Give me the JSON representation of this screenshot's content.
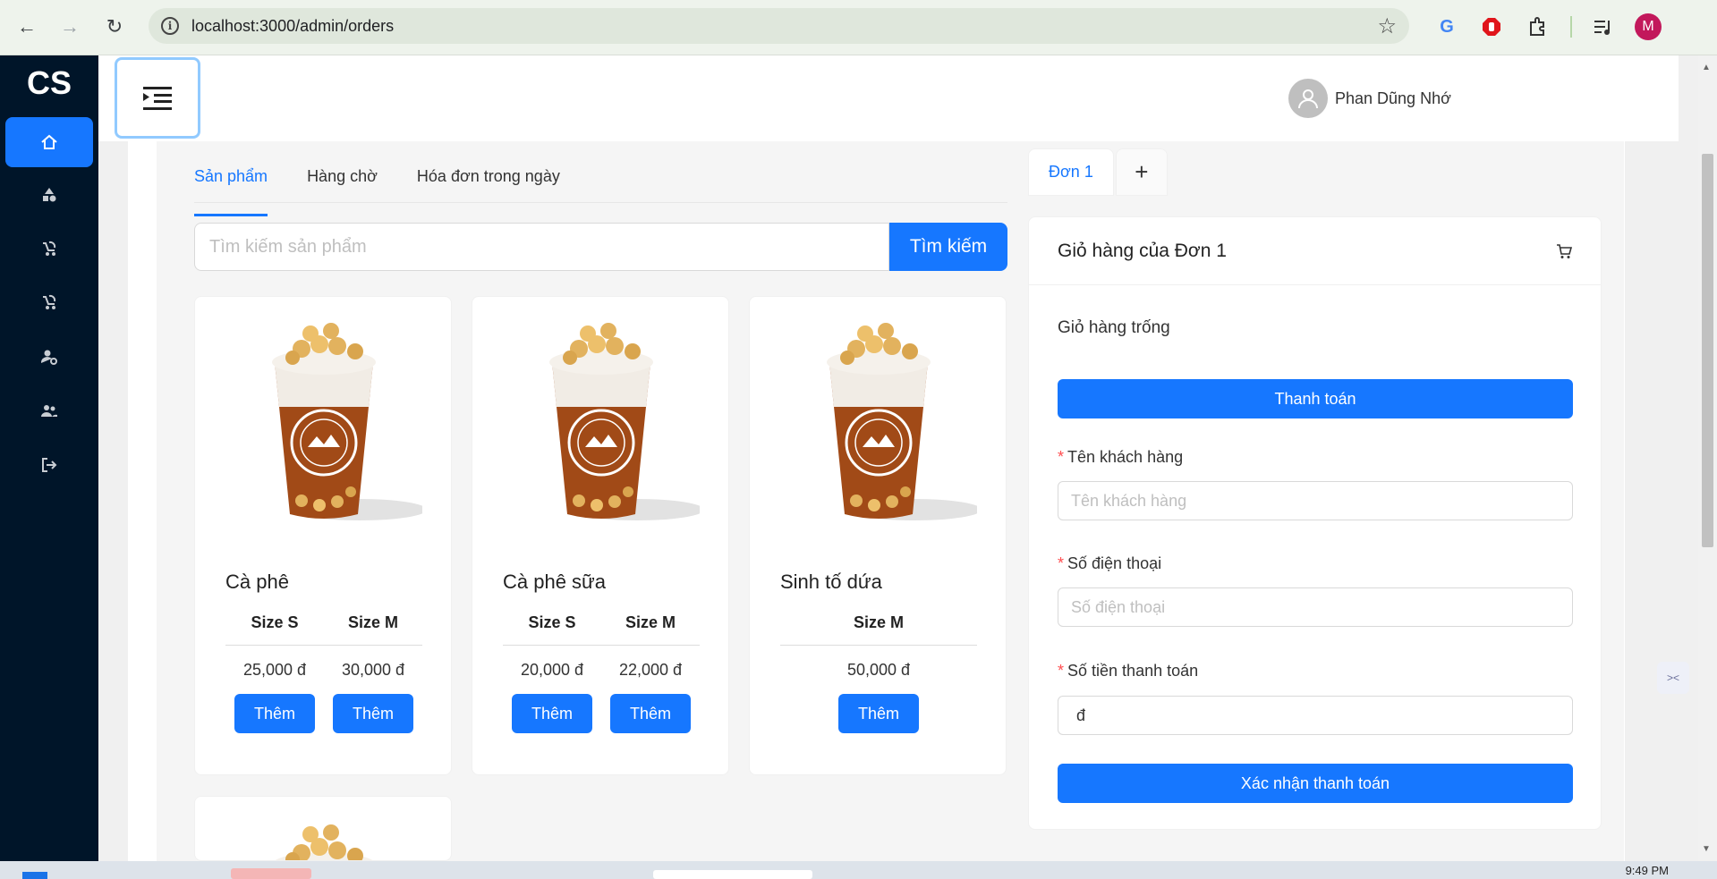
{
  "browser": {
    "url": "localhost:3000/admin/orders",
    "profile_initial": "M"
  },
  "app": {
    "logo": "CS",
    "user_name": "Phan Dũng Nhớ",
    "sidebar_icons": [
      "home-icon",
      "shapes-icon",
      "stroller-icon",
      "stroller-icon-2",
      "user-settings-icon",
      "team-icon",
      "logout-icon"
    ]
  },
  "tabs": [
    "Sản phẩm",
    "Hàng chờ",
    "Hóa đơn trong ngày"
  ],
  "search": {
    "placeholder": "Tìm kiếm sản phẩm",
    "button": "Tìm kiếm"
  },
  "products": [
    {
      "name": "Cà phê",
      "sizes": [
        "Size S",
        "Size M"
      ],
      "prices": [
        "25,000 đ",
        "30,000 đ"
      ],
      "add_labels": [
        "Thêm",
        "Thêm"
      ]
    },
    {
      "name": "Cà phê sữa",
      "sizes": [
        "Size S",
        "Size M"
      ],
      "prices": [
        "20,000 đ",
        "22,000 đ"
      ],
      "add_labels": [
        "Thêm",
        "Thêm"
      ]
    },
    {
      "name": "Sinh tố dứa",
      "sizes": [
        "Size M"
      ],
      "prices": [
        "50,000 đ"
      ],
      "add_labels": [
        "Thêm"
      ]
    }
  ],
  "order_tabs": {
    "active": "Đơn 1",
    "add": "+"
  },
  "cart": {
    "title": "Giỏ hàng của Đơn 1",
    "empty_text": "Giỏ hàng trống",
    "pay_button": "Thanh toán",
    "customer_label": "Tên khách hàng",
    "customer_placeholder": "Tên khách hàng",
    "phone_label": "Số điện thoại",
    "phone_placeholder": "Số điện thoại",
    "amount_label": "Số tiền thanh toán",
    "amount_value": "đ",
    "confirm_button": "Xác nhận thanh toán",
    "required_mark": "*"
  },
  "taskbar": {
    "clock": "9:49 PM"
  },
  "colors": {
    "primary": "#1677ff",
    "sidebar": "#001529"
  }
}
